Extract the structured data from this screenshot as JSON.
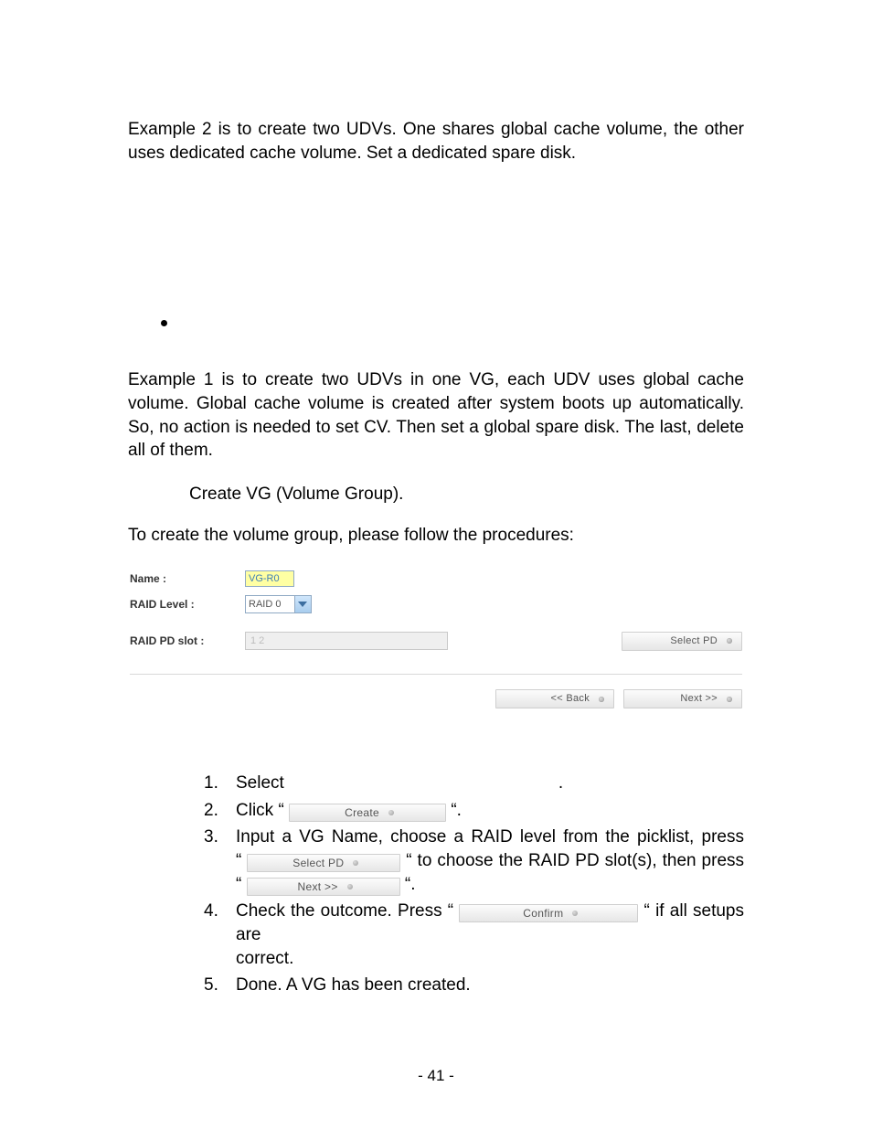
{
  "intro_para_1": "Example 2 is to create two UDVs. One shares global cache volume, the other uses dedicated cache volume. Set a dedicated spare disk.",
  "intro_para_2": "Example 1 is to create two UDVs in one VG, each UDV uses global cache volume. Global cache volume is created after system boots up automatically. So, no action is needed to set CV. Then set a global spare disk. The last, delete all of them.",
  "step1_heading": "Create VG (Volume Group).",
  "to_create_line": "To create the volume group, please follow the procedures:",
  "ui": {
    "labels": {
      "name": "Name :",
      "raid_level": "RAID Level :",
      "raid_pd_slot": "RAID PD slot :"
    },
    "name_value": "VG-R0",
    "raid_level_value": "RAID 0",
    "pd_slot_value": "1 2",
    "buttons": {
      "select_pd": "Select PD",
      "back": "<< Back",
      "next": "Next >>"
    }
  },
  "ol": {
    "n1": "1.",
    "n2": "2.",
    "n3": "3.",
    "n4": "4.",
    "n5": "5.",
    "item1_a": "Select",
    "item1_b": ".",
    "item2_a": "Click “ ",
    "item2_b": " “.",
    "item3_line1": "Input a VG Name, choose a RAID level from the picklist, press",
    "item3_q1a": "“ ",
    "item3_mid": " “ to choose the RAID PD slot(s), then press",
    "item3_q2a": "“ ",
    "item3_end": " “.",
    "item4_a": "Check the outcome. Press “ ",
    "item4_b": " “ if all setups are ",
    "item4_c": "correct.",
    "item5": "Done. A VG has been created."
  },
  "inline_buttons": {
    "create": "Create",
    "select_pd": "Select PD",
    "next": "Next >>",
    "confirm": "Confirm"
  },
  "page_number": "- 41 -"
}
